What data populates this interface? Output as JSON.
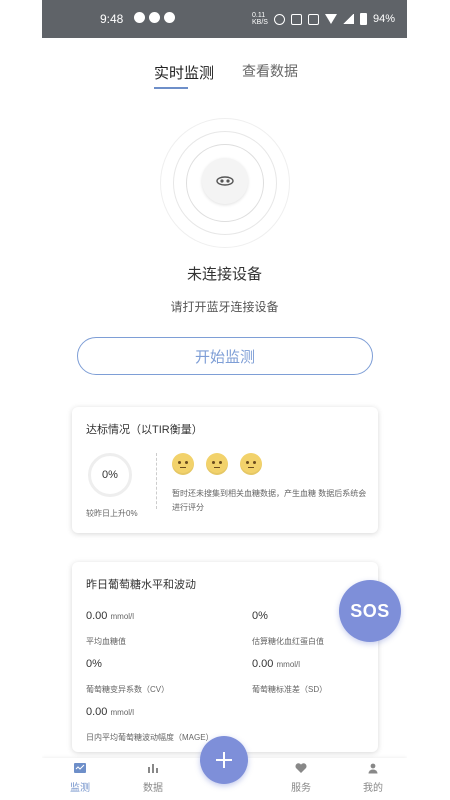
{
  "status_bar": {
    "time": "9:48",
    "speed_top": "0.11",
    "speed_unit": "KB/S",
    "battery": "94%"
  },
  "tabs": [
    {
      "label": "实时监测",
      "active": true
    },
    {
      "label": "查看数据",
      "active": false
    }
  ],
  "connection": {
    "title": "未连接设备",
    "subtitle": "请打开蓝牙连接设备"
  },
  "start_button": {
    "label": "开始监测"
  },
  "tir_card": {
    "title": "达标情况（以TIR衡量）",
    "percent": "0%",
    "compare": "较昨日上升0%",
    "message": "暂时还未搜集到相关血糖数据，产生血糖 数据后系统会进行评分"
  },
  "glucose_card": {
    "title": "昨日葡萄糖水平和波动",
    "avg_value": "0.00",
    "avg_unit": "mmol/l",
    "avg_label": "平均血糖值",
    "hba1c_value": "0%",
    "hba1c_label": "估算糖化血红蛋白值",
    "cv_value": "0%",
    "cv_label": "葡萄糖变异系数（CV）",
    "sd_value": "0.00",
    "sd_unit": "mmol/l",
    "sd_label": "葡萄糖标准差（SD）",
    "mage_value": "0.00",
    "mage_unit": "mmol/l",
    "mage_label": "日内平均葡萄糖波动幅度（MAGE）"
  },
  "sos": {
    "label": "SOS"
  },
  "bottom_nav": [
    {
      "label": "监测",
      "icon": "monitor-icon",
      "active": true
    },
    {
      "label": "数据",
      "icon": "bar-chart-icon",
      "active": false
    },
    {
      "label": "服务",
      "icon": "heart-icon",
      "active": false
    },
    {
      "label": "我的",
      "icon": "person-icon",
      "active": false
    }
  ],
  "colors": {
    "accent": "#7e9ed6",
    "fab": "#7e8fd9",
    "status_bar": "#5f6368"
  }
}
